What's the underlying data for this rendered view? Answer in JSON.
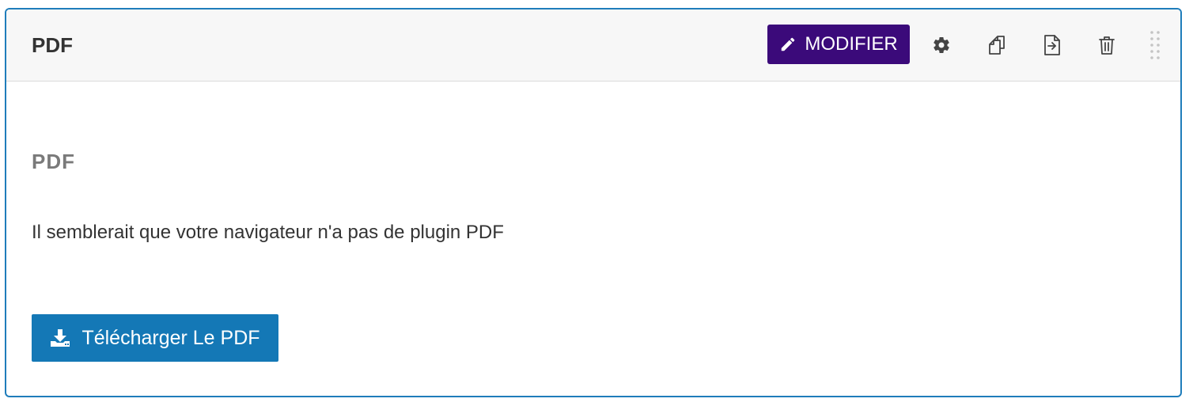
{
  "block": {
    "title": "PDF",
    "toolbar": {
      "edit_label": "MODIFIER",
      "icons": [
        "gear-icon",
        "copy-icon",
        "export-icon",
        "trash-icon",
        "drag-handle-icon"
      ]
    }
  },
  "content": {
    "heading": "PDF",
    "message": "Il semblerait que votre navigateur n'a pas de plugin PDF",
    "download_label": "Télécharger Le PDF",
    "download_icon": "download-icon"
  },
  "colors": {
    "accent_border": "#1f7dbb",
    "edit_button": "#3b0a7a",
    "download_button": "#1478b6"
  }
}
